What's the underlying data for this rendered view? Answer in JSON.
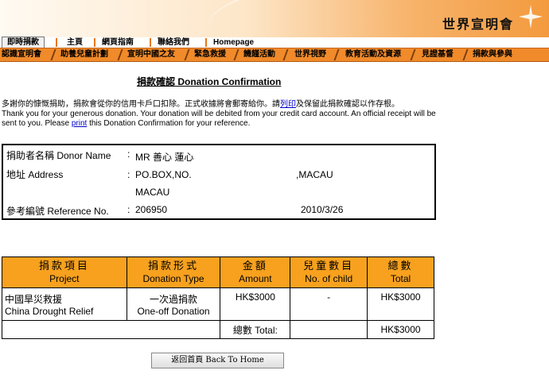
{
  "header": {
    "logo_text": "世界宣明會"
  },
  "nav_top": {
    "items": [
      "即時捐款",
      "主頁",
      "網頁指南",
      "聯絡我們",
      "Homepage"
    ]
  },
  "nav_main": {
    "items": [
      "認識宣明會",
      "助養兒童計劃",
      "宣明中國之友",
      "緊急救援",
      "饑饉活動",
      "世界視野",
      "教育活動及資源",
      "見證基督",
      "捐款與參與"
    ]
  },
  "page": {
    "title": "捐款確認 Donation Confirmation",
    "intro_zh_1": "多謝你的慷慨捐助，捐款會從你的信用卡戶口扣除。正式收據將會郵寄給你。請",
    "intro_zh_link": "列印",
    "intro_zh_2": "及保留此捐款確認以作存根。",
    "intro_en_1": "Thank you for your generous donation. Your donation will be debited from your credit card account. An official receipt will be sent to you. Please ",
    "intro_en_link": "print",
    "intro_en_2": " this Donation Confirmation for your reference."
  },
  "donor": {
    "name_label": "捐助者名稱 Donor Name",
    "name_value": "MR 善心 蓮心",
    "address_label": "地址 Address",
    "address_line1": "PO.BOX,NO.",
    "address_line1_city": ",MACAU",
    "address_line2": "MACAU",
    "ref_label": "參考編號 Reference No.",
    "ref_value": "206950",
    "date": "2010/3/26",
    "colon": ":"
  },
  "table": {
    "headers": [
      {
        "zh": "捐款項目",
        "en": "Project"
      },
      {
        "zh": "捐款形式",
        "en": "Donation Type"
      },
      {
        "zh": "金額",
        "en": "Amount"
      },
      {
        "zh": "兒童數目",
        "en": "No. of child"
      },
      {
        "zh": "總數",
        "en": "Total"
      }
    ],
    "row": {
      "project_zh": "中國旱災救援",
      "project_en": "China Drought Relief",
      "type_zh": "一次過捐款",
      "type_en": "One-off Donation",
      "amount": "HK$3000",
      "children": "-",
      "total": "HK$3000"
    },
    "total_label": "總數 Total:",
    "total_value": "HK$3000"
  },
  "button": {
    "back_home": "返回首頁 Back To Home"
  },
  "colors": {
    "orange_nav": "#f08a2a",
    "table_header": "#f7a11e"
  }
}
